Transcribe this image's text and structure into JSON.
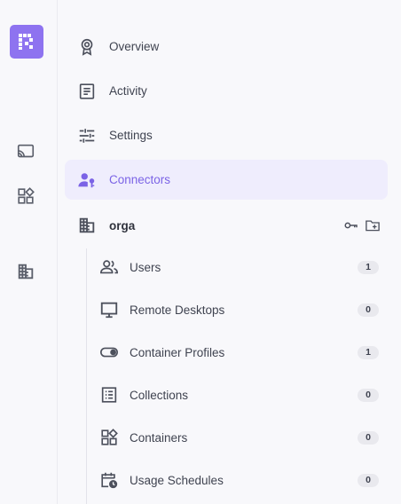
{
  "rail": {
    "items": [
      {
        "name": "cast-icon"
      },
      {
        "name": "widgets-icon"
      },
      {
        "name": "building-icon"
      }
    ]
  },
  "nav": {
    "items": [
      {
        "label": "Overview",
        "icon": "award-icon"
      },
      {
        "label": "Activity",
        "icon": "document-icon"
      },
      {
        "label": "Settings",
        "icon": "sliders-icon"
      },
      {
        "label": "Connectors",
        "icon": "user-key-icon",
        "active": true
      }
    ]
  },
  "org": {
    "label": "orga",
    "icon": "building-icon",
    "actions": [
      "key-icon",
      "folder-add-icon"
    ]
  },
  "tree": {
    "items": [
      {
        "label": "Users",
        "count": "1",
        "icon": "users-icon"
      },
      {
        "label": "Remote Desktops",
        "count": "0",
        "icon": "monitor-icon"
      },
      {
        "label": "Container Profiles",
        "count": "1",
        "icon": "toggle-icon"
      },
      {
        "label": "Collections",
        "count": "0",
        "icon": "list-icon"
      },
      {
        "label": "Containers",
        "count": "0",
        "icon": "widgets-icon"
      },
      {
        "label": "Usage Schedules",
        "count": "0",
        "icon": "calendar-clock-icon"
      }
    ]
  },
  "colors": {
    "accent": "#8e73f0",
    "active_bg": "#efedfd",
    "active_text": "#7b63e6"
  }
}
